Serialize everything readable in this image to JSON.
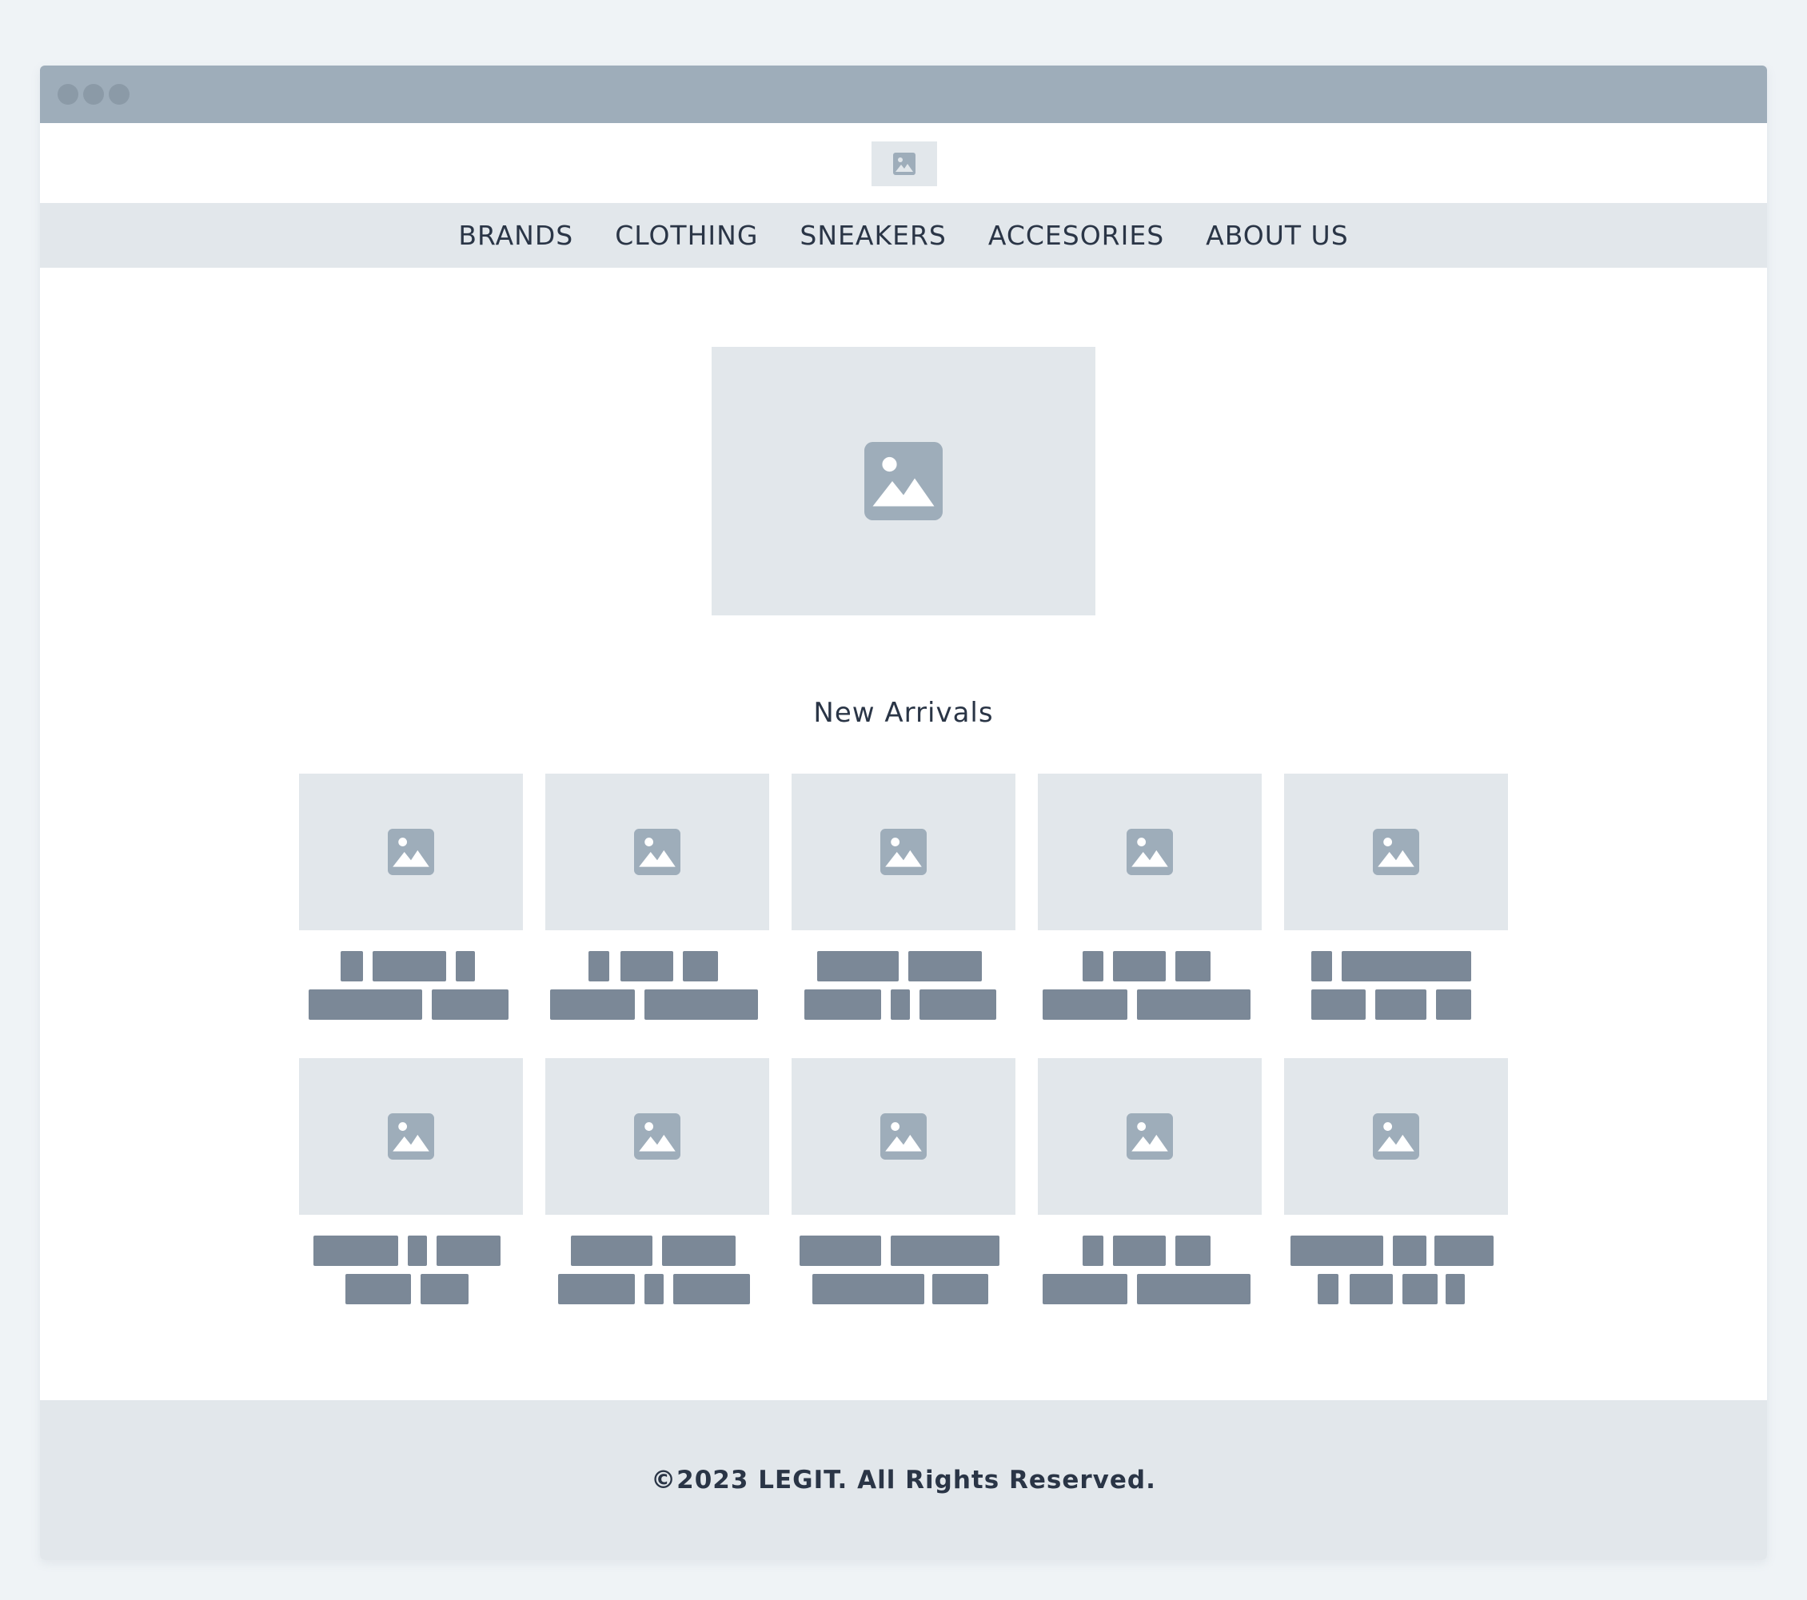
{
  "nav": {
    "items": [
      {
        "label": "BRANDS"
      },
      {
        "label": "CLOTHING"
      },
      {
        "label": "SNEAKERS"
      },
      {
        "label": "ACCESORIES"
      },
      {
        "label": "ABOUT US"
      }
    ]
  },
  "logo": {
    "icon": "image-placeholder-icon"
  },
  "hero": {
    "icon": "image-placeholder-icon"
  },
  "new_arrivals": {
    "title": "New Arrivals",
    "products_count_visible": 10,
    "product_icon": "image-placeholder-icon"
  },
  "footer": {
    "text": "©2023 LEGIT. All Rights Reserved."
  },
  "colors": {
    "page_background": "#eff3f6",
    "titlebar": "#9eadba",
    "placeholder_fill": "#e2e7eb",
    "placeholder_icon": "#9eadba",
    "text_block": "#7b8897",
    "text": "#2a3546"
  }
}
